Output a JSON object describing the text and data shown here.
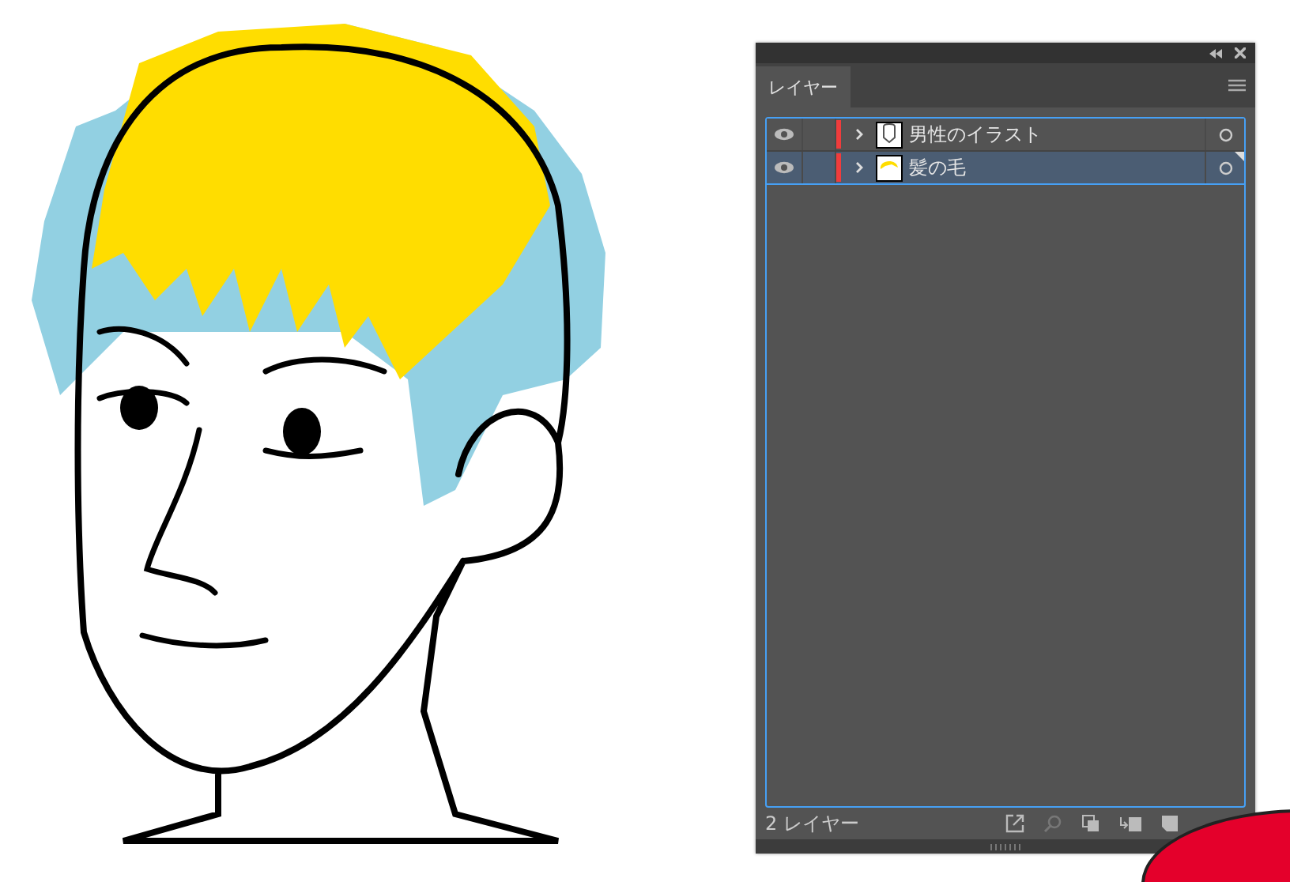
{
  "panel": {
    "tab": {
      "label": "レイヤー",
      "selected": true
    },
    "layers": [
      {
        "name": "男性のイラスト",
        "selected": false
      },
      {
        "name": "髪の毛",
        "selected": true
      }
    ],
    "status": "2 レイヤー"
  }
}
